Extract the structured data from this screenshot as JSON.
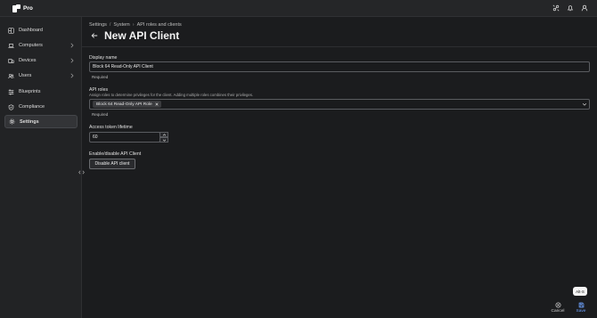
{
  "app": {
    "name": "Pro"
  },
  "topbar": {
    "icons": [
      "integrations-icon",
      "bell-icon",
      "user-icon"
    ]
  },
  "sidebar": {
    "items": [
      {
        "label": "Dashboard",
        "icon": "dashboard-icon",
        "has_chevron": false,
        "active": false
      },
      {
        "label": "Computers",
        "icon": "laptop-icon",
        "has_chevron": true,
        "active": false
      },
      {
        "label": "Devices",
        "icon": "devices-icon",
        "has_chevron": true,
        "active": false
      },
      {
        "label": "Users",
        "icon": "users-icon",
        "has_chevron": true,
        "active": false
      },
      {
        "label": "Blueprints",
        "icon": "blueprints-icon",
        "has_chevron": false,
        "active": false
      },
      {
        "label": "Compliance",
        "icon": "shield-icon",
        "has_chevron": false,
        "active": false
      },
      {
        "label": "Settings",
        "icon": "gear-icon",
        "has_chevron": false,
        "active": true
      }
    ]
  },
  "breadcrumb": [
    "Settings",
    "System",
    "API roles and clients"
  ],
  "page": {
    "title": "New API Client"
  },
  "form": {
    "display_name": {
      "label": "Display name",
      "value": "Block 64 Read-Only API Client",
      "helper": "Required"
    },
    "api_roles": {
      "label": "API roles",
      "hint": "Assign roles to determine privileges for the client. Adding multiple roles combines their privileges.",
      "selected": [
        "Block 64 Read-Only API Role"
      ],
      "helper": "Required"
    },
    "token_lifetime": {
      "label": "Access token lifetime",
      "value": "60"
    },
    "enable": {
      "label": "Enable/disable API Client",
      "button": "Disable API client"
    }
  },
  "footer": {
    "tooltip": "Alt-S",
    "cancel_label": "Cancel",
    "save_label": "Save"
  },
  "colors": {
    "accent": "#6fa3ff",
    "background": "#1b1c1e",
    "sidebar": "#222325"
  }
}
